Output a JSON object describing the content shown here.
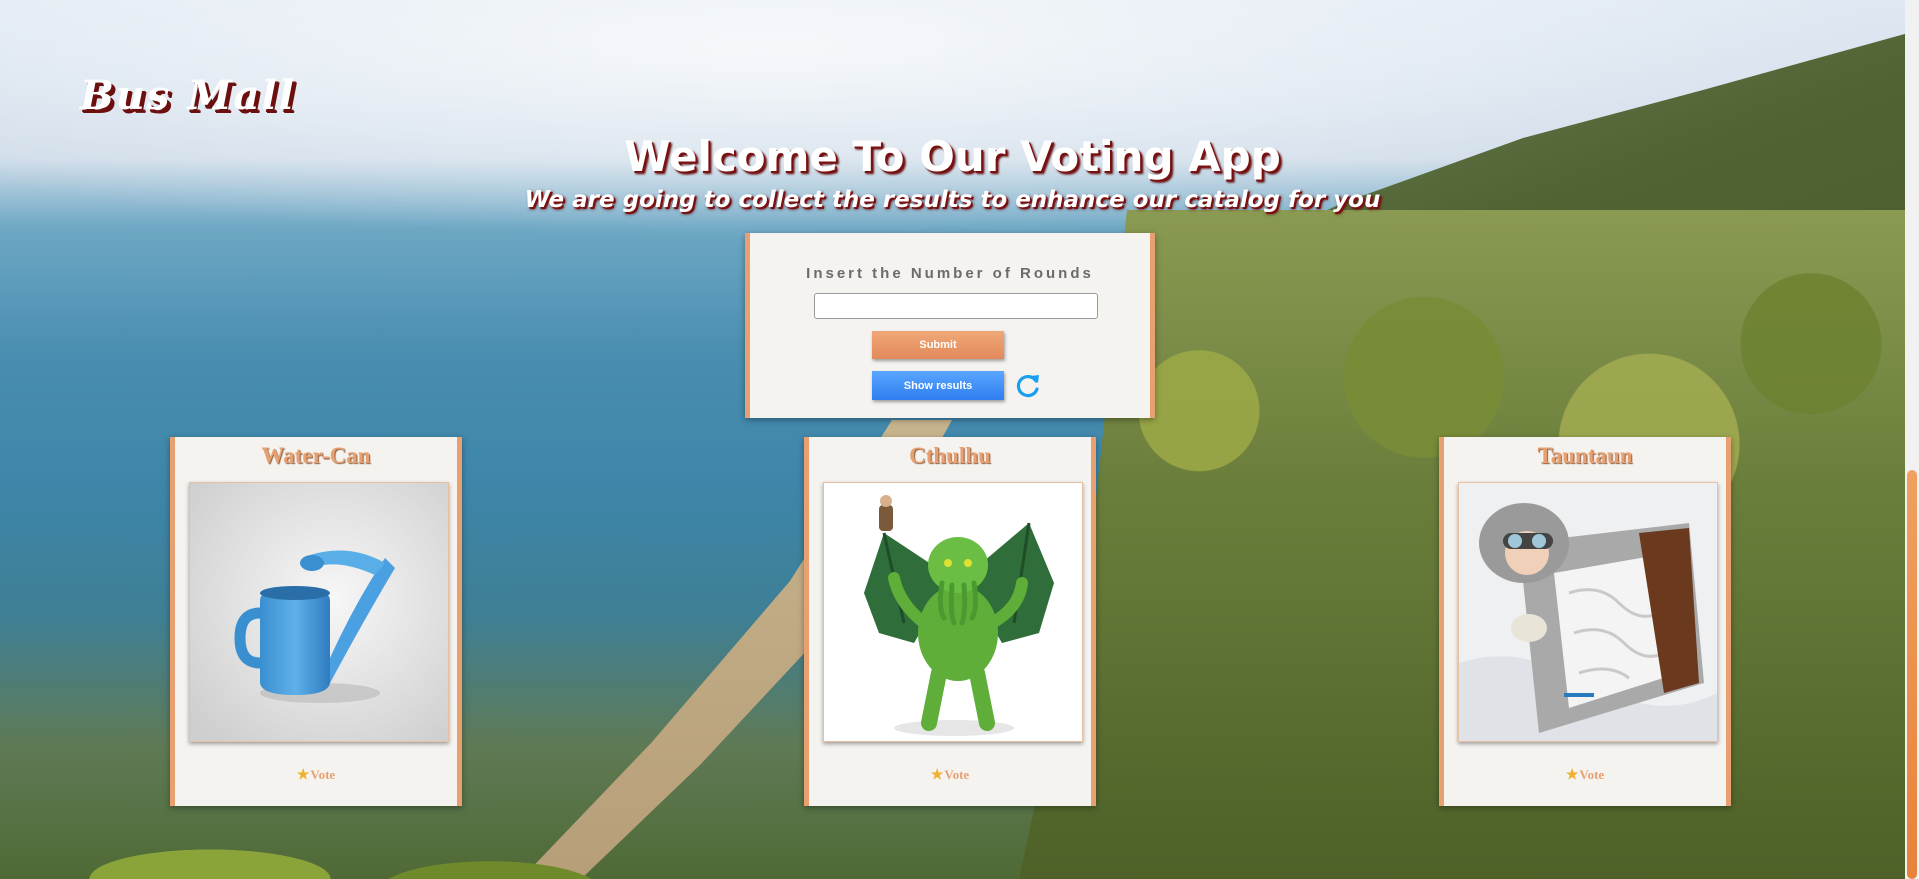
{
  "brand": {
    "logo": "Bus Mall"
  },
  "header": {
    "title": "Welcome To Our Voting App",
    "subtitle": "We are going to collect the results to enhance our catalog for you"
  },
  "form": {
    "label": "Insert the Number of Rounds",
    "input_value": "",
    "submit_label": "Submit",
    "results_label": "Show results",
    "refresh_icon": "refresh-icon"
  },
  "products": [
    {
      "name": "Water-Can",
      "vote_label": "Vote",
      "image": "blue watering can"
    },
    {
      "name": "Cthulhu",
      "vote_label": "Vote",
      "image": "green winged monster figure"
    },
    {
      "name": "Tauntaun",
      "vote_label": "Vote",
      "image": "tauntaun sleeping bag"
    }
  ],
  "colors": {
    "accent": "#e8a070",
    "results_button": "#2f7df0",
    "logo_shadow": "#6b0f0f"
  }
}
